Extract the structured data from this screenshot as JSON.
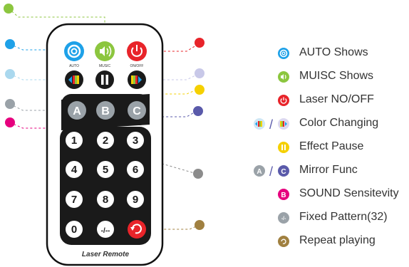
{
  "remote": {
    "brand_label": "Laser Remote",
    "top_buttons": [
      {
        "label": "AUTO",
        "color": "#1ea1e8"
      },
      {
        "label": "MUSIC",
        "color": "#8cc63f"
      },
      {
        "label": "ON/OFF",
        "color": "#e8242a"
      }
    ],
    "letter_buttons": [
      "A",
      "B",
      "C"
    ],
    "number_buttons": [
      "1",
      "2",
      "3",
      "4",
      "5",
      "6",
      "7",
      "8",
      "9",
      "0",
      "-/--"
    ]
  },
  "legend": [
    {
      "text": "AUTO Shows",
      "icon": "auto-icon",
      "color": "#1ea1e8"
    },
    {
      "text": "MUISC Shows",
      "icon": "music-icon",
      "color": "#8cc63f"
    },
    {
      "text": "Laser NO/OFF",
      "icon": "power-icon",
      "color": "#e8242a"
    },
    {
      "text": "Color Changing",
      "icon": "color-change-icon",
      "color": "#c8c8e8"
    },
    {
      "text": "Effect Pause",
      "icon": "pause-icon",
      "color": "#f5d000"
    },
    {
      "text": "Mirror Func",
      "icon": "mirror-icon",
      "color": "#5a5aaa"
    },
    {
      "text": "SOUND Sensitevity",
      "icon": "sound-icon",
      "color": "#e6007e"
    },
    {
      "text": "Fixed Pattern(32)",
      "icon": "pattern-icon",
      "color": "#9aa2a8"
    },
    {
      "text": "Repeat playing",
      "icon": "repeat-icon",
      "color": "#a08040"
    }
  ],
  "legend_glyphs": {
    "b": "B",
    "a": "A",
    "c": "C",
    "dash": "-/-"
  }
}
